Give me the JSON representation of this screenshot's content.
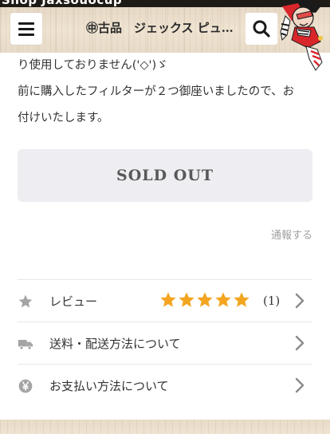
{
  "top_strip": {
    "text": "Shop Jaxsouocup"
  },
  "header": {
    "title": "㊥古品　ジェックス ピュ…",
    "menu_icon": "hamburger-menu-icon",
    "search_icon": "search-icon",
    "mascot": "mascot-character-image"
  },
  "description": {
    "lines": [
      "り使用しておりません('◇')ゞ",
      "前に購入したフィルターが２つ御座いましたので、お",
      "付けいたします。"
    ]
  },
  "purchase": {
    "sold_out_label": "SOLD OUT"
  },
  "report": {
    "label": "通報する"
  },
  "rows": {
    "review": {
      "label": "レビュー",
      "icon": "star-icon",
      "rating": 5,
      "max_rating": 5,
      "count": "(1)"
    },
    "shipping": {
      "label": "送料・配送方法について",
      "icon": "truck-icon"
    },
    "payment": {
      "label": "お支払い方法について",
      "icon": "yen-icon"
    }
  },
  "colors": {
    "star_fill": "#f3a521",
    "row_icon": "#a4a4a4",
    "chevron": "#8a8a8a",
    "sold_out_bg": "#eeeef2"
  }
}
